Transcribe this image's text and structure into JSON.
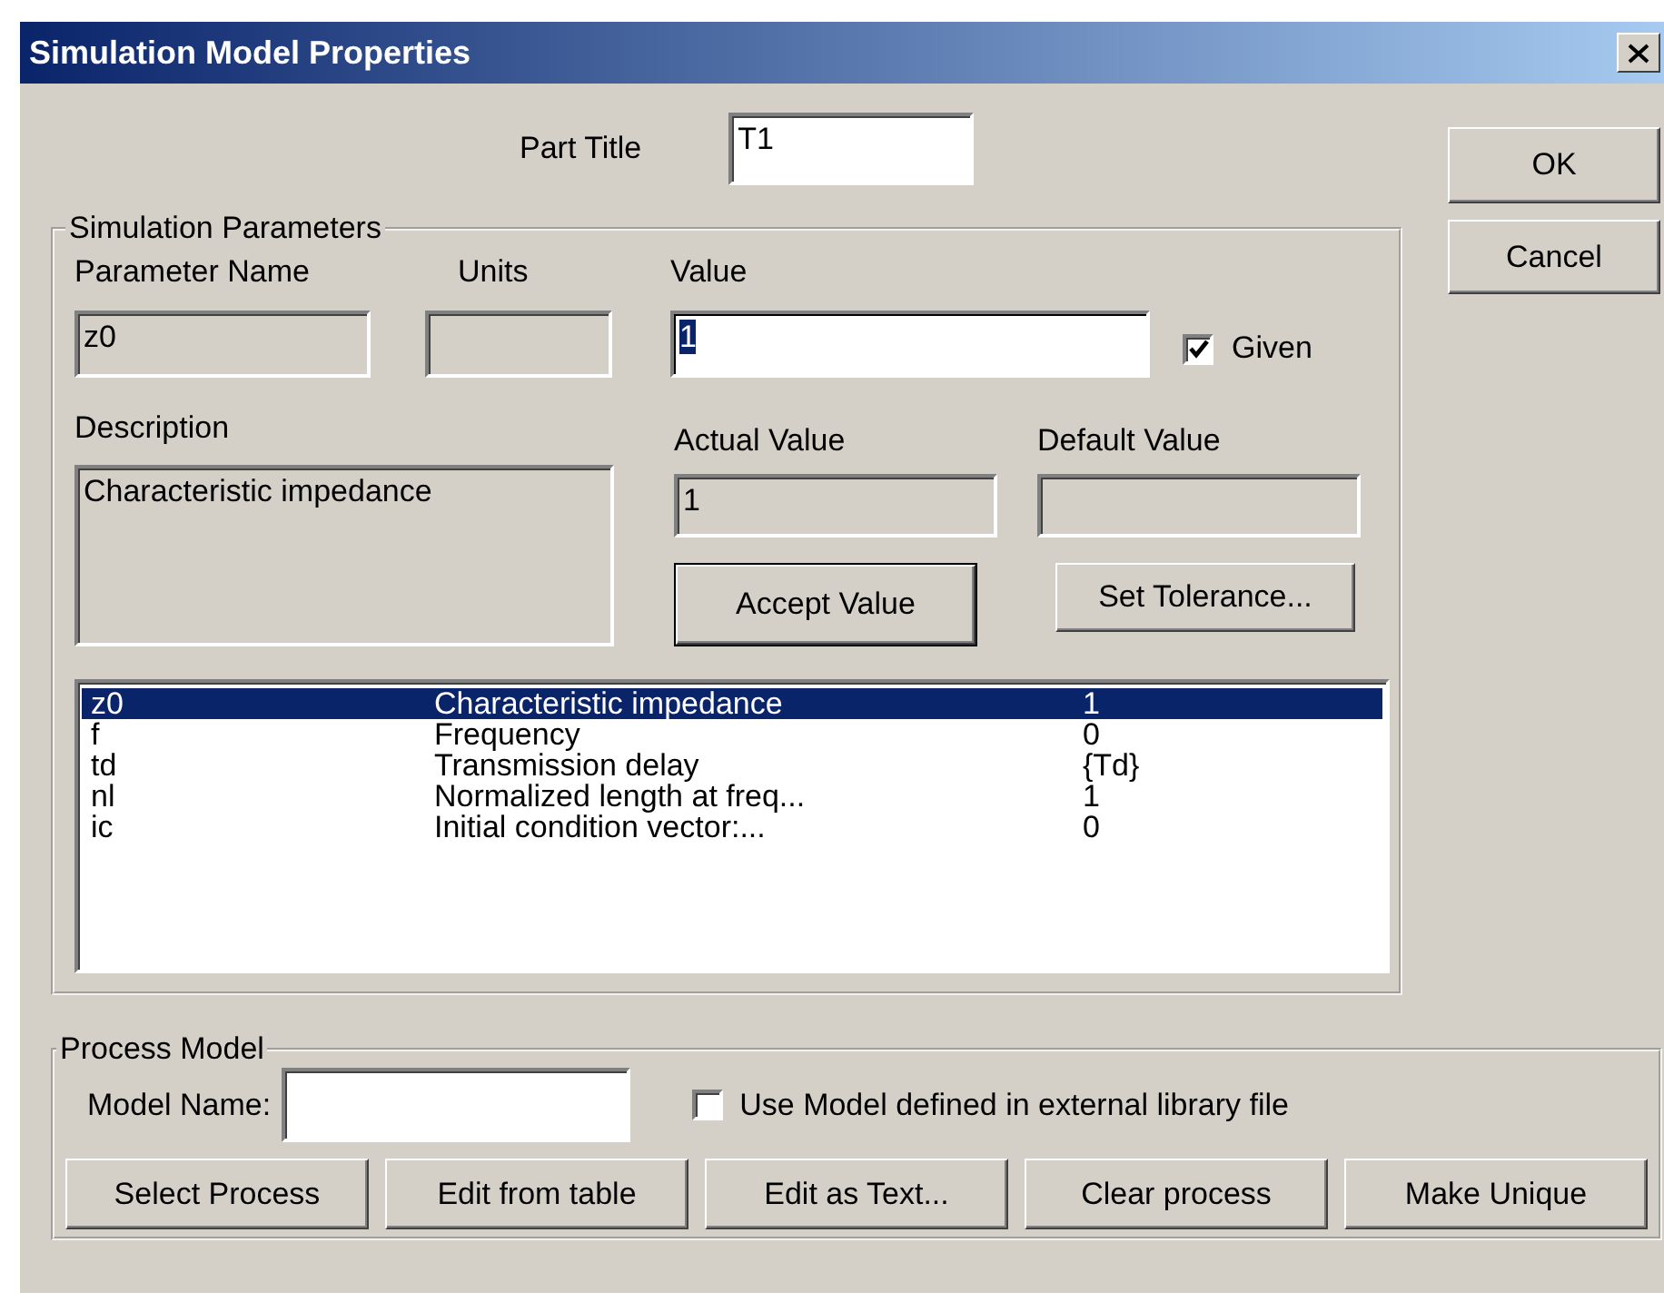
{
  "window": {
    "title": "Simulation Model Properties"
  },
  "part_title": {
    "label": "Part Title",
    "value": "T1"
  },
  "dialog_buttons": [
    "OK",
    "Cancel"
  ],
  "simulation_parameters": {
    "title": "Simulation Parameters",
    "parameter_name": {
      "label": "Parameter Name",
      "value": "z0"
    },
    "units": {
      "label": "Units"
    },
    "value": {
      "label": "Value",
      "value": "1"
    },
    "given": {
      "label": "Given",
      "checked": true
    },
    "description": {
      "label": "Description",
      "value": "Characteristic impedance"
    },
    "actual_value": {
      "label": "Actual Value",
      "value": "1"
    },
    "default_value": {
      "label": "Default Value"
    },
    "accept_button": "Accept Value",
    "tolerance_button": "Set Tolerance...",
    "parameters": [
      {
        "name": "z0",
        "description": "Characteristic impedance",
        "value": "1",
        "selected": true
      },
      {
        "name": "f",
        "description": "Frequency",
        "value": "0",
        "selected": false
      },
      {
        "name": "td",
        "description": "Transmission delay",
        "value": "{Td}",
        "selected": false
      },
      {
        "name": "nl",
        "description": "Normalized length at freq...",
        "value": "1",
        "selected": false
      },
      {
        "name": "ic",
        "description": "Initial condition vector:...",
        "value": "0",
        "selected": false
      }
    ]
  },
  "process_model": {
    "title": "Process Model",
    "model_name": {
      "label": "Model Name:"
    },
    "use_external": {
      "label": "Use Model defined in external library file",
      "checked": false
    },
    "buttons": [
      "Select Process",
      "Edit from table",
      "Edit as Text...",
      "Clear process",
      "Make Unique"
    ]
  }
}
